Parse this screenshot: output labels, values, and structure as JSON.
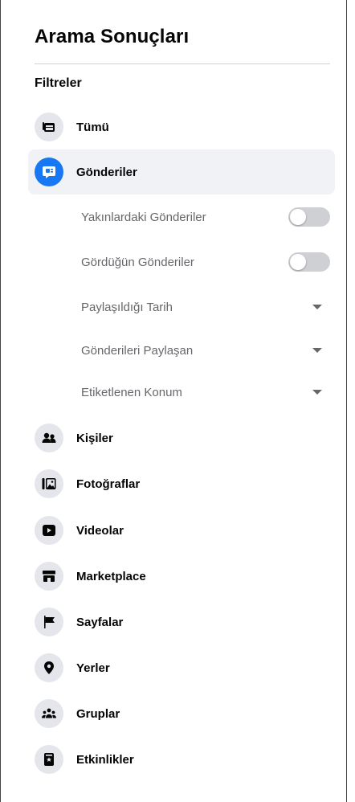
{
  "header": {
    "title": "Arama Sonuçları",
    "filters_label": "Filtreler"
  },
  "categories": {
    "all": {
      "label": "Tümü",
      "icon": "all-icon"
    },
    "posts": {
      "label": "Gönderiler",
      "icon": "posts-icon",
      "selected": true
    },
    "people": {
      "label": "Kişiler",
      "icon": "people-icon"
    },
    "photos": {
      "label": "Fotoğraflar",
      "icon": "photos-icon"
    },
    "videos": {
      "label": "Videolar",
      "icon": "videos-icon"
    },
    "marketplace": {
      "label": "Marketplace",
      "icon": "marketplace-icon"
    },
    "pages": {
      "label": "Sayfalar",
      "icon": "pages-icon"
    },
    "places": {
      "label": "Yerler",
      "icon": "places-icon"
    },
    "groups": {
      "label": "Gruplar",
      "icon": "groups-icon"
    },
    "events": {
      "label": "Etkinlikler",
      "icon": "events-icon"
    }
  },
  "post_filters": {
    "nearby": {
      "label": "Yakınlardaki Gönderiler",
      "toggle_on": false
    },
    "seen": {
      "label": "Gördüğün Gönderiler",
      "toggle_on": false
    },
    "date": {
      "label": "Paylaşıldığı Tarih"
    },
    "posted_by": {
      "label": "Gönderileri Paylaşan"
    },
    "tagged_location": {
      "label": "Etiketlenen Konum"
    }
  },
  "colors": {
    "accent": "#1877f2",
    "icon_bg": "#e4e6eb",
    "selected_bg": "#f0f2f5",
    "toggle_off": "#ced0d4"
  }
}
